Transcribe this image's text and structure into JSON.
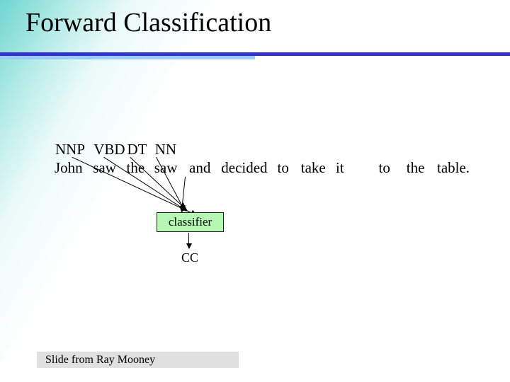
{
  "title": "Forward Classification",
  "tags": [
    "NNP",
    "VBD",
    "DT",
    "NN",
    "",
    "",
    "",
    "",
    "",
    "",
    "",
    "",
    ""
  ],
  "sentence": [
    "John",
    "saw",
    "the",
    "saw",
    "and",
    "decided",
    "to",
    "take",
    "it",
    "",
    "to",
    "the",
    "table."
  ],
  "classifier_label": "classifier",
  "output_tag": "CC",
  "footer": "Slide from Ray Mooney"
}
